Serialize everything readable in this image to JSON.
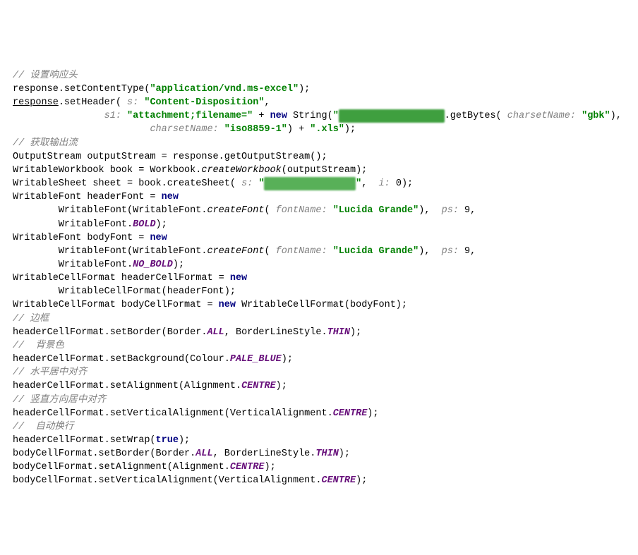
{
  "lines": {
    "c1": "// 设置响应头",
    "l2_a": "response.setContentType(",
    "l2_b": "\"application/vnd.ms-excel\"",
    "l2_c": ");",
    "l3_a": "response",
    "l3_b": ".setHeader( ",
    "l3_p1": "s: ",
    "l3_s1": "\"Content-Disposition\"",
    "l3_c": ",",
    "l4_p2": "s1: ",
    "l4_s2": "\"attachment;filename=\"",
    "l4_d": " + ",
    "l4_new": "new ",
    "l4_e": "String(",
    "l4_blur": "██████████████████",
    "l4_f": ".getBytes( ",
    "l4_p3": "charsetName: ",
    "l4_s3": "\"gbk\"",
    "l4_g": "),",
    "l5_p4": "charsetName: ",
    "l5_s4": "\"iso8859-1\"",
    "l5_h": ") + ",
    "l5_s5": "\".xls\"",
    "l5_i": ");",
    "c2": "// 获取输出流",
    "l7": "OutputStream outputStream = response.getOutputStream();",
    "l8_a": "WritableWorkbook book = Workbook.",
    "l8_b": "createWorkbook",
    "l8_c": "(outputStream);",
    "l9_a": "WritableSheet sheet = book.createSheet( ",
    "l9_p1": "s: ",
    "l9_blur": "\"████████████████\"",
    "l9_b": ",  ",
    "l9_p2": "i: ",
    "l9_v": "0",
    "l9_c": ");",
    "l10_a": "WritableFont headerFont = ",
    "l10_b": "new",
    "l11_a": "        WritableFont(WritableFont.",
    "l11_b": "createFont",
    "l11_c": "( ",
    "l11_p": "fontName: ",
    "l11_s": "\"Lucida Grande\"",
    "l11_d": "),  ",
    "l11_p2": "ps: ",
    "l11_v": "9",
    "l11_e": ",",
    "l12_a": "        WritableFont.",
    "l12_b": "BOLD",
    "l12_c": ");",
    "l13_a": "WritableFont bodyFont = ",
    "l13_b": "new",
    "l14_a": "        WritableFont(WritableFont.",
    "l14_b": "createFont",
    "l14_c": "( ",
    "l14_p": "fontName: ",
    "l14_s": "\"Lucida Grande\"",
    "l14_d": "),  ",
    "l14_p2": "ps: ",
    "l14_v": "9",
    "l14_e": ",",
    "l15_a": "        WritableFont.",
    "l15_b": "NO_BOLD",
    "l15_c": ");",
    "l16_a": "WritableCellFormat headerCellFormat = ",
    "l16_b": "new",
    "l17_a": "        WritableCellFormat(headerFont);",
    "l18_a": "WritableCellFormat bodyCellFormat = ",
    "l18_b": "new ",
    "l18_c": "WritableCellFormat(bodyFont);",
    "c3": "// 边框",
    "l20_a": "headerCellFormat.setBorder(Border.",
    "l20_b": "ALL",
    "l20_c": ", BorderLineStyle.",
    "l20_d": "THIN",
    "l20_e": ");",
    "c4": "//  背景色",
    "l22_a": "headerCellFormat.setBackground(Colour.",
    "l22_b": "PALE_BLUE",
    "l22_c": ");",
    "c5": "// 水平居中对齐",
    "l24_a": "headerCellFormat.setAlignment(Alignment.",
    "l24_b": "CENTRE",
    "l24_c": ");",
    "c6": "// 竖直方向居中对齐",
    "l26_a": "headerCellFormat.setVerticalAlignment(VerticalAlignment.",
    "l26_b": "CENTRE",
    "l26_c": ");",
    "c7": "//  自动换行",
    "l28_a": "headerCellFormat.setWrap(",
    "l28_b": "true",
    "l28_c": ");",
    "l29_a": "bodyCellFormat.setBorder(Border.",
    "l29_b": "ALL",
    "l29_c": ", BorderLineStyle.",
    "l29_d": "THIN",
    "l29_e": ");",
    "l30_a": "bodyCellFormat.setAlignment(Alignment.",
    "l30_b": "CENTRE",
    "l30_c": ");",
    "l31_a": "bodyCellFormat.setVerticalAlignment(VerticalAlignment.",
    "l31_b": "CENTRE",
    "l31_c": ");"
  }
}
